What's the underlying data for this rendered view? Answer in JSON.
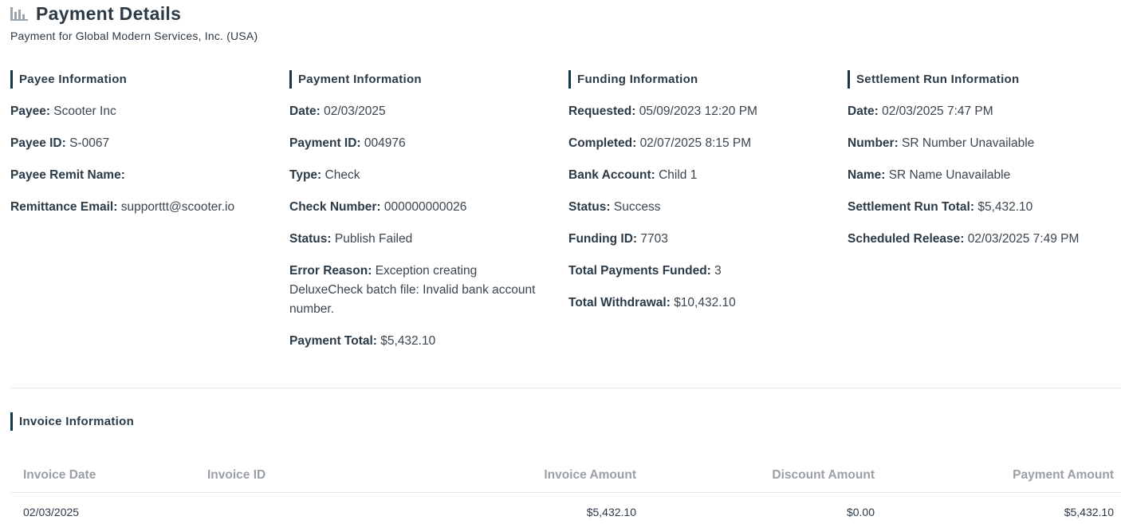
{
  "header": {
    "icon": "bar-chart-icon",
    "title": "Payment Details",
    "subtitle": "Payment for Global Modern Services, Inc. (USA)"
  },
  "sections": {
    "payee": {
      "title": "Payee Information",
      "fields": [
        {
          "label": "Payee:",
          "value": "Scooter Inc"
        },
        {
          "label": "Payee ID:",
          "value": "S-0067"
        },
        {
          "label": "Payee Remit Name:",
          "value": ""
        },
        {
          "label": "Remittance Email:",
          "value": "supporttt@scooter.io"
        }
      ]
    },
    "payment": {
      "title": "Payment Information",
      "fields": [
        {
          "label": "Date:",
          "value": "02/03/2025"
        },
        {
          "label": "Payment ID:",
          "value": "004976"
        },
        {
          "label": "Type:",
          "value": "Check"
        },
        {
          "label": "Check Number:",
          "value": "000000000026"
        },
        {
          "label": "Status:",
          "value": "Publish Failed"
        },
        {
          "label": "Error Reason:",
          "value": "Exception creating DeluxeCheck batch file: Invalid bank account number."
        },
        {
          "label": "Payment Total:",
          "value": "$5,432.10"
        }
      ]
    },
    "funding": {
      "title": "Funding Information",
      "fields": [
        {
          "label": "Requested:",
          "value": "05/09/2023 12:20 PM"
        },
        {
          "label": "Completed:",
          "value": "02/07/2025 8:15 PM"
        },
        {
          "label": "Bank Account:",
          "value": "Child 1"
        },
        {
          "label": "Status:",
          "value": "Success"
        },
        {
          "label": "Funding ID:",
          "value": "7703"
        },
        {
          "label": "Total Payments Funded:",
          "value": "3"
        },
        {
          "label": "Total Withdrawal:",
          "value": "$10,432.10"
        }
      ]
    },
    "settlement": {
      "title": "Settlement Run Information",
      "fields": [
        {
          "label": "Date:",
          "value": "02/03/2025 7:47 PM"
        },
        {
          "label": "Number:",
          "value": "SR Number Unavailable"
        },
        {
          "label": "Name:",
          "value": "SR Name Unavailable"
        },
        {
          "label": "Settlement Run Total:",
          "value": "$5,432.10"
        },
        {
          "label": "Scheduled Release:",
          "value": "02/03/2025 7:49 PM"
        }
      ]
    }
  },
  "invoice": {
    "title": "Invoice Information",
    "columns": [
      "Invoice Date",
      "Invoice ID",
      "Invoice Amount",
      "Discount Amount",
      "Payment Amount"
    ],
    "rows": [
      [
        "02/03/2025",
        "",
        "$5,432.10",
        "$0.00",
        "$5,432.10"
      ]
    ]
  },
  "colors": {
    "accent_bar": "#14384a",
    "text": "#2b3a47",
    "header_muted": "#9aa0a6",
    "divider": "#e6e6e6"
  }
}
